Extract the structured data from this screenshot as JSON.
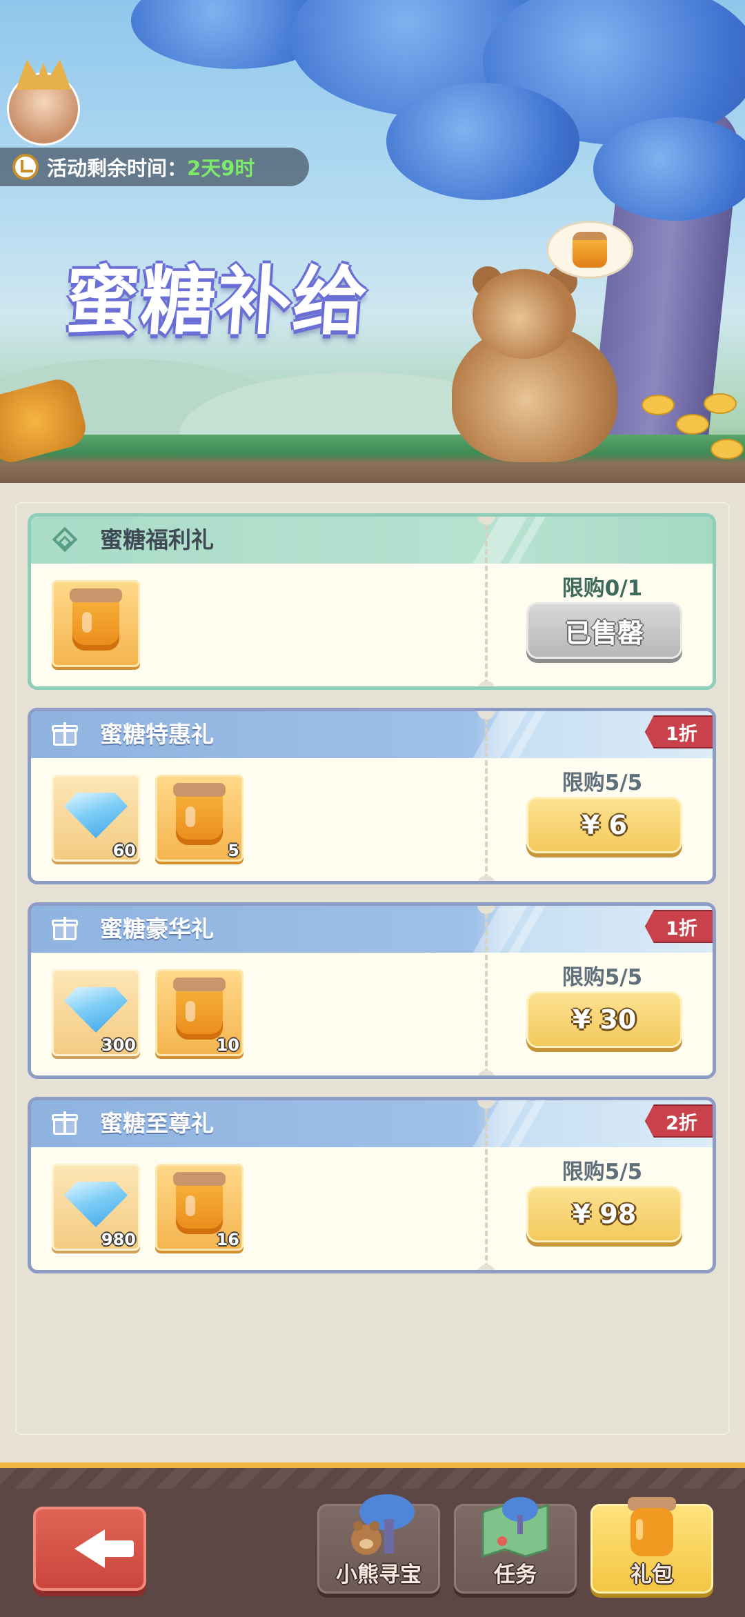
{
  "banner": {
    "title": "蜜糖补给",
    "timer_label": "活动剩余时间：",
    "timer_value": "2天9时"
  },
  "packs": [
    {
      "name": "蜜糖福利礼",
      "limit": "限购0/1",
      "button": "已售罄",
      "state": "sold-out",
      "discount": "",
      "items": [
        {
          "type": "honey-jar",
          "qty": ""
        }
      ]
    },
    {
      "name": "蜜糖特惠礼",
      "limit": "限购5/5",
      "button": "¥ 6",
      "state": "buy",
      "discount": "1折",
      "items": [
        {
          "type": "diamond",
          "qty": "60"
        },
        {
          "type": "honey-jar",
          "qty": "5"
        }
      ]
    },
    {
      "name": "蜜糖豪华礼",
      "limit": "限购5/5",
      "button": "¥ 30",
      "state": "buy",
      "discount": "1折",
      "items": [
        {
          "type": "diamond",
          "qty": "300"
        },
        {
          "type": "honey-jar",
          "qty": "10"
        }
      ]
    },
    {
      "name": "蜜糖至尊礼",
      "limit": "限购5/5",
      "button": "¥ 98",
      "state": "buy",
      "discount": "2折",
      "items": [
        {
          "type": "diamond",
          "qty": "980"
        },
        {
          "type": "honey-jar",
          "qty": "16"
        }
      ]
    }
  ],
  "nav": {
    "back_icon": "arrow-left-icon",
    "tabs": [
      {
        "label": "小熊寻宝",
        "icon": "bear-tree-icon",
        "active": false
      },
      {
        "label": "任务",
        "icon": "map-icon",
        "active": false
      },
      {
        "label": "礼包",
        "icon": "honey-jar-icon",
        "active": true
      }
    ]
  },
  "colors": {
    "accent_gold": "#f2c85a",
    "discount_red": "#c9414a",
    "timer_green": "#7eea6a"
  }
}
